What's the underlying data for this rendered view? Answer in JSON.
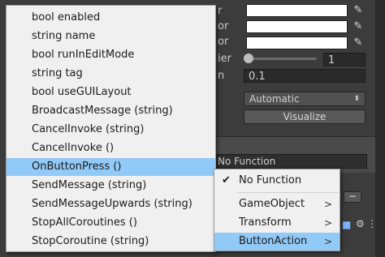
{
  "inspector": {
    "row_labels": [
      "r",
      "or",
      "or",
      "ier",
      "n"
    ],
    "slider_value": "1",
    "float_value": "0.1",
    "navigation_value": "Automatic",
    "visualize_label": "Visualize",
    "function_value": "No Function",
    "minus_label": "−"
  },
  "menu": {
    "items": [
      {
        "label": "bool enabled"
      },
      {
        "label": "string name"
      },
      {
        "label": "bool runInEditMode"
      },
      {
        "label": "string tag"
      },
      {
        "label": "bool useGUILayout"
      },
      {
        "label": "BroadcastMessage (string)"
      },
      {
        "label": "CancelInvoke (string)"
      },
      {
        "label": "CancelInvoke ()"
      },
      {
        "label": "OnButtonPress ()"
      },
      {
        "label": "SendMessage (string)"
      },
      {
        "label": "SendMessageUpwards (string)"
      },
      {
        "label": "StopAllCoroutines ()"
      },
      {
        "label": "StopCoroutine (string)"
      }
    ],
    "highlighted_index": 8
  },
  "submenu": {
    "check_icon": "check-icon",
    "items": [
      {
        "label": "No Function",
        "checked": true
      },
      {
        "label": "GameObject",
        "has_submenu": true
      },
      {
        "label": "Transform",
        "has_submenu": true
      },
      {
        "label": "ButtonAction",
        "has_submenu": true
      }
    ],
    "highlighted_index": 3
  },
  "colors": {
    "highlight": "#91c9f7",
    "menu_bg": "#f0f0f0",
    "inspector_bg": "#3c3c3c"
  }
}
